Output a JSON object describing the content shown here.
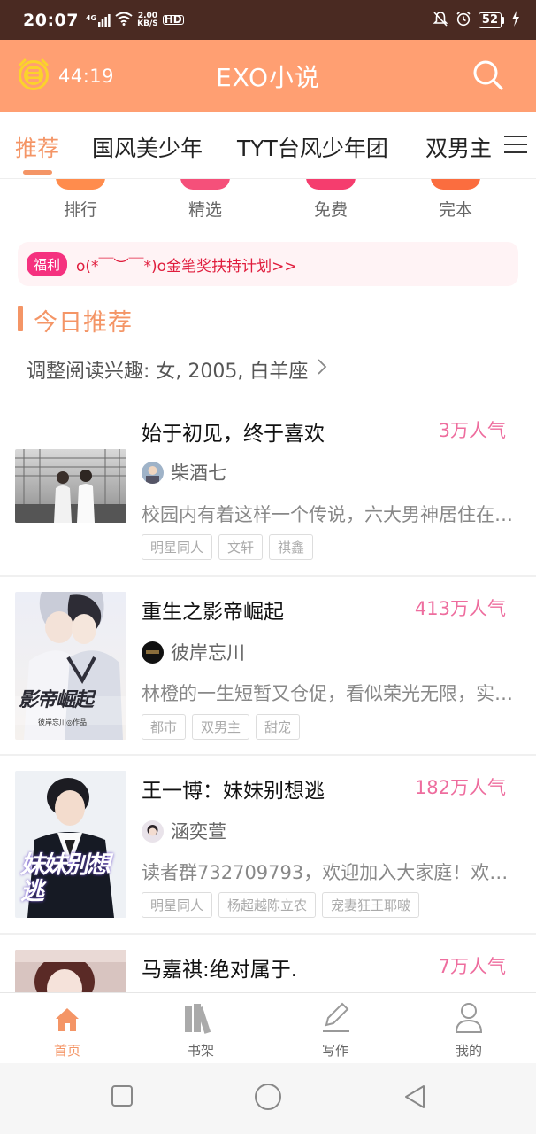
{
  "status_bar": {
    "time": "20:07",
    "network": "4G",
    "speed_value": "2.00",
    "speed_unit": "KB/S",
    "hd": "HD",
    "battery": "52"
  },
  "header": {
    "timer": "44:19",
    "title": "EXO小说"
  },
  "tabs": [
    {
      "label": "推荐",
      "active": true
    },
    {
      "label": "国风美少年",
      "active": false
    },
    {
      "label": "TYT台风少年团",
      "active": false
    },
    {
      "label": "双男主",
      "active": false
    }
  ],
  "quick_entries": [
    {
      "label": "排行",
      "color": "#ff8c4d"
    },
    {
      "label": "精选",
      "color": "#f5507a"
    },
    {
      "label": "免费",
      "color": "#f53d6e"
    },
    {
      "label": "完本",
      "color": "#fb6d3f"
    }
  ],
  "welfare": {
    "badge": "福利",
    "text": "o(*￣︶￣*)o金笔奖扶持计划>>"
  },
  "section": {
    "title": "今日推荐",
    "preference": "调整阅读兴趣: 女, 2005, 白羊座"
  },
  "books": [
    {
      "title": "始于初见，终于喜欢",
      "popularity": "3万人气",
      "author": "柴酒七",
      "description": "校园内有着这样一个传说，六大男神居住在一起……",
      "tags": [
        "明星同人",
        "文轩",
        "祺鑫"
      ]
    },
    {
      "title": "重生之影帝崛起",
      "popularity": "413万人气",
      "author": "彼岸忘川",
      "description": "林橙的一生短暂又仓促，看似荣光无限，实则……",
      "tags": [
        "都市",
        "双男主",
        "甜宠"
      ],
      "cover_text": "影帝崛起",
      "cover_sub": "彼岸忘川◎作品"
    },
    {
      "title": "王一博：妹妹别想逃",
      "popularity": "182万人气",
      "author": "涵奕萱",
      "description": "读者群732709793，欢迎加入大家庭！欢迎……",
      "tags": [
        "明星同人",
        "杨超越陈立农",
        "宠妻狂王耶啵"
      ],
      "cover_text": "妹妹别想逃"
    },
    {
      "title": "马嘉祺:绝对属于.",
      "popularity": "7万人气"
    }
  ],
  "bottom_nav": [
    {
      "label": "首页",
      "icon": "home-icon",
      "active": true
    },
    {
      "label": "书架",
      "icon": "bookshelf-icon",
      "active": false
    },
    {
      "label": "写作",
      "icon": "pen-icon",
      "active": false
    },
    {
      "label": "我的",
      "icon": "user-icon",
      "active": false
    }
  ],
  "colors": {
    "accent": "#f49566",
    "header_bg": "#ff9f72",
    "popularity": "#ee6d9e",
    "welfare_text": "#e01d3d"
  }
}
